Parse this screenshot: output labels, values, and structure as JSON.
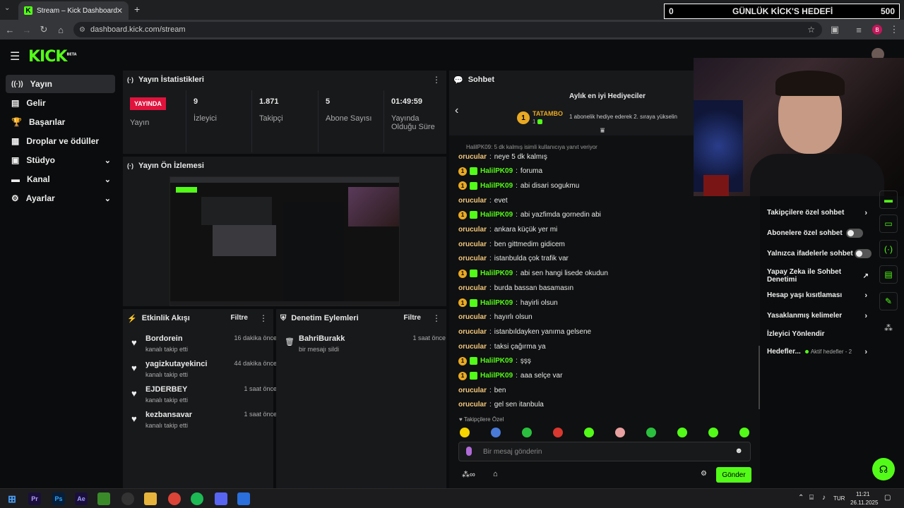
{
  "browser": {
    "tab_title": "Stream – Kick Dashboard",
    "url": "dashboard.kick.com/stream",
    "profile_initial": "B"
  },
  "goal_overlay": {
    "current": "0",
    "title": "GÜNLÜK KİCK'S HEDEFİ",
    "target": "500"
  },
  "brand": {
    "logo": "KICK",
    "logo_sup": "BETA"
  },
  "sidebar": {
    "items": [
      {
        "label": "Yayın",
        "icon": "broadcast-icon"
      },
      {
        "label": "Gelir",
        "icon": "money-icon"
      },
      {
        "label": "Başarılar",
        "icon": "trophy-icon"
      },
      {
        "label": "Droplar ve ödüller",
        "icon": "gift-icon"
      },
      {
        "label": "Stüdyo",
        "icon": "studio-icon"
      },
      {
        "label": "Kanal",
        "icon": "channel-icon"
      },
      {
        "label": "Ayarlar",
        "icon": "gear-icon"
      }
    ]
  },
  "stats": {
    "title": "Yayın İstatistikleri",
    "live_badge": "YAYINDA",
    "live_label": "Yayın",
    "viewers": {
      "value": "9",
      "label": "İzleyici"
    },
    "followers": {
      "value": "1.871",
      "label": "Takipçi"
    },
    "subs": {
      "value": "5",
      "label": "Abone Sayısı"
    },
    "uptime": {
      "value": "01:49:59",
      "label": "Yayında Olduğu Süre"
    }
  },
  "preview": {
    "title": "Yayın Ön İzlemesi"
  },
  "activity": {
    "title": "Etkinlik Akışı",
    "filter": "Filtre",
    "events": [
      {
        "name": "Bordorein",
        "sub": "kanalı takip etti",
        "time": "16 dakika önce"
      },
      {
        "name": "yagizkutayekinci",
        "sub": "kanalı takip etti",
        "time": "44 dakika önce"
      },
      {
        "name": "EJDERBEY",
        "sub": "kanalı takip etti",
        "time": "1 saat önce"
      },
      {
        "name": "kezbansavar",
        "sub": "kanalı takip etti",
        "time": "1 saat önce"
      }
    ]
  },
  "moderation": {
    "title": "Denetim Eylemleri",
    "filter": "Filtre",
    "events": [
      {
        "name": "BahriBurakk",
        "sub": "bir mesajı sildi",
        "time": "1 saat önce"
      }
    ]
  },
  "chat": {
    "title": "Sohbet",
    "gifters_title": "Aylık en iyi Hediyeciler",
    "top_gifter": "TATAMBO",
    "top_gifter_count": "1",
    "gift_note": "1 abonelik hediye ederek 2. sıraya yükselin",
    "typing": "HalilPK09: 5 dk kalmış isimli kullanıcıya yanıt veriyor",
    "messages": [
      {
        "user": "orucular",
        "text": "neye 5 dk kalmış",
        "sub": false
      },
      {
        "user": "HalilPK09",
        "text": "foruma",
        "sub": true
      },
      {
        "user": "HalilPK09",
        "text": "abi disari sogukmu",
        "sub": true
      },
      {
        "user": "orucular",
        "text": "evet",
        "sub": false
      },
      {
        "user": "HalilPK09",
        "text": "abi yazfimda gornedin abi",
        "sub": true
      },
      {
        "user": "orucular",
        "text": "ankara küçük yer mi",
        "sub": false
      },
      {
        "user": "orucular",
        "text": "ben gittmedim gidicem",
        "sub": false
      },
      {
        "user": "orucular",
        "text": "istanbulda çok trafik var",
        "sub": false
      },
      {
        "user": "HalilPK09",
        "text": "abi sen hangi lisede okudun",
        "sub": true
      },
      {
        "user": "orucular",
        "text": "burda bassan basamasın",
        "sub": false
      },
      {
        "user": "HalilPK09",
        "text": "hayirli olsun",
        "sub": true
      },
      {
        "user": "orucular",
        "text": "hayırlı olsun",
        "sub": false
      },
      {
        "user": "orucular",
        "text": "istanbıldayken yanıma gelsene",
        "sub": false
      },
      {
        "user": "orucular",
        "text": "taksi çağırma ya",
        "sub": false
      },
      {
        "user": "HalilPK09",
        "text": "şşş",
        "sub": true
      },
      {
        "user": "HalilPK09",
        "text": "aaa selçe var",
        "sub": true
      },
      {
        "user": "orucular",
        "text": "ben",
        "sub": false
      },
      {
        "user": "orucular",
        "text": "gel sen itanbula",
        "sub": false
      }
    ],
    "followers_only": "Takipçilere Özel",
    "input_placeholder": "Bir mesaj gönderin",
    "send": "Gönder"
  },
  "chat_settings": {
    "followers_only": "Takipçilere özel sohbet",
    "subs_only": "Abonelere özel sohbet",
    "emotes_only": "Yalnızca ifadelerle sohbet",
    "ai_mod": "Yapay Zeka ile Sohbet Denetimi",
    "account_age": "Hesap yaşı kısıtlaması",
    "banned_words": "Yasaklanmış kelimeler",
    "redirect": "İzleyici Yönlendir",
    "goals": "Hedefler...",
    "goals_active": "Aktif hedefler - 2"
  },
  "taskbar": {
    "lang": "TUR",
    "time": "11:21",
    "date": "26.11.2025"
  },
  "colors": {
    "accent": "#53fc18",
    "live": "#e0133d",
    "gold": "#e9a923"
  }
}
